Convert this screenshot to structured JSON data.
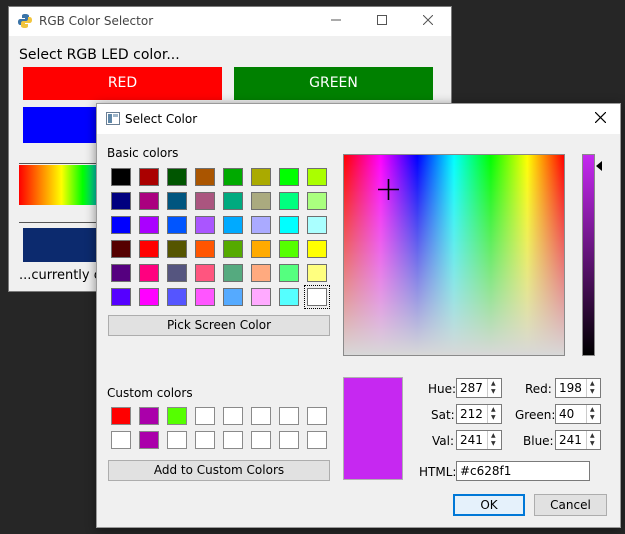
{
  "main_window": {
    "title": "RGB Color Selector",
    "prompt": "Select RGB LED color...",
    "red_label": "RED",
    "green_label": "GREEN",
    "status_text": "...currently co"
  },
  "dialog": {
    "title": "Select Color",
    "basic_colors_label": "Basic colors",
    "pick_screen_label": "Pick Screen Color",
    "custom_colors_label": "Custom colors",
    "add_custom_label": "Add to Custom Colors",
    "hue_label": "Hue:",
    "hue": "287",
    "sat_label": "Sat:",
    "sat": "212",
    "val_label": "Val:",
    "val": "241",
    "red_label": "Red:",
    "red": "198",
    "green_label": "Green:",
    "green": "40",
    "blue_label": "Blue:",
    "blue": "241",
    "html_label": "HTML:",
    "html": "#c628f1",
    "ok_label": "OK",
    "cancel_label": "Cancel",
    "current_color": "#c628f1",
    "basic_colors": [
      "#000000",
      "#aa0000",
      "#005500",
      "#aa5500",
      "#00aa00",
      "#aaaa00",
      "#00ff00",
      "#aaff00",
      "#00007f",
      "#aa007f",
      "#00557f",
      "#aa557f",
      "#00aa7f",
      "#aaaa7f",
      "#00ff7f",
      "#aaff7f",
      "#0000ff",
      "#aa00ff",
      "#0055ff",
      "#aa55ff",
      "#00aaff",
      "#aaaaff",
      "#00ffff",
      "#aaffff",
      "#550000",
      "#ff0000",
      "#555500",
      "#ff5500",
      "#55aa00",
      "#ffaa00",
      "#55ff00",
      "#ffff00",
      "#55007f",
      "#ff007f",
      "#55557f",
      "#ff557f",
      "#55aa7f",
      "#ffaa7f",
      "#55ff7f",
      "#ffff7f",
      "#5500ff",
      "#ff00ff",
      "#5555ff",
      "#ff55ff",
      "#55aaff",
      "#ffaaff",
      "#55ffff",
      "#ffffff"
    ],
    "custom_colors": [
      "#ff0000",
      "#aa00aa",
      "#55ff00",
      "#ffffff",
      "#ffffff",
      "#ffffff",
      "#ffffff",
      "#ffffff",
      "#ffffff",
      "#aa00aa",
      "#ffffff",
      "#ffffff",
      "#ffffff",
      "#ffffff",
      "#ffffff",
      "#ffffff"
    ]
  }
}
